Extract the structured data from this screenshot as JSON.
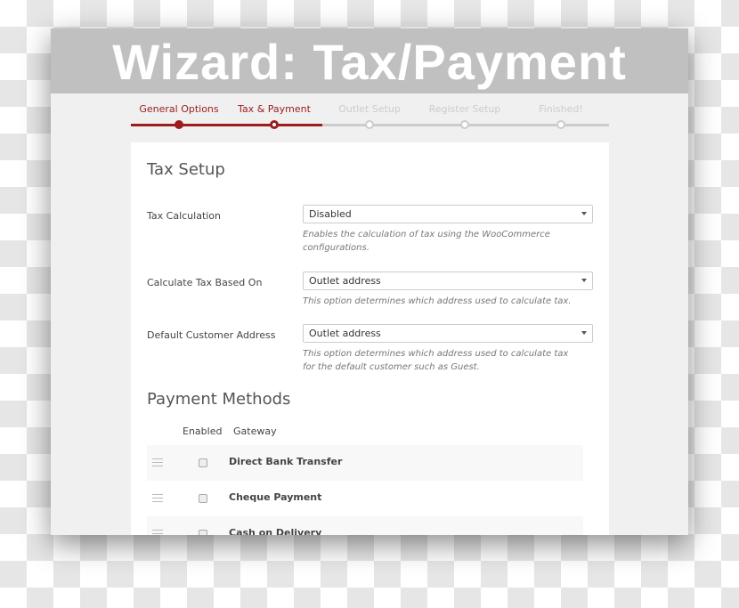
{
  "window": {
    "title": "Wizard: Tax/Payment"
  },
  "steps": [
    {
      "label": "General Options",
      "state": "done"
    },
    {
      "label": "Tax & Payment",
      "state": "current"
    },
    {
      "label": "Outlet Setup",
      "state": "todo"
    },
    {
      "label": "Register Setup",
      "state": "todo"
    },
    {
      "label": "Finished!",
      "state": "todo"
    }
  ],
  "colors": {
    "accent": "#9b1c1c",
    "inactive": "#cccccc"
  },
  "tax": {
    "heading": "Tax Setup",
    "fields": [
      {
        "label": "Tax Calculation",
        "value": "Disabled",
        "help": "Enables the calculation of tax using the WooCommerce configurations."
      },
      {
        "label": "Calculate Tax Based On",
        "value": "Outlet address",
        "help": "This option determines which address used to calculate tax."
      },
      {
        "label": "Default Customer Address",
        "value": "Outlet address",
        "help": "This option determines which address used to calculate tax for the default customer such as Guest."
      }
    ]
  },
  "payment": {
    "heading": "Payment Methods",
    "col_enabled": "Enabled",
    "col_gateway": "Gateway",
    "gateways": [
      {
        "name": "Direct Bank Transfer",
        "enabled": false
      },
      {
        "name": "Cheque Payment",
        "enabled": false
      },
      {
        "name": "Cash on Delivery",
        "enabled": false
      }
    ]
  }
}
